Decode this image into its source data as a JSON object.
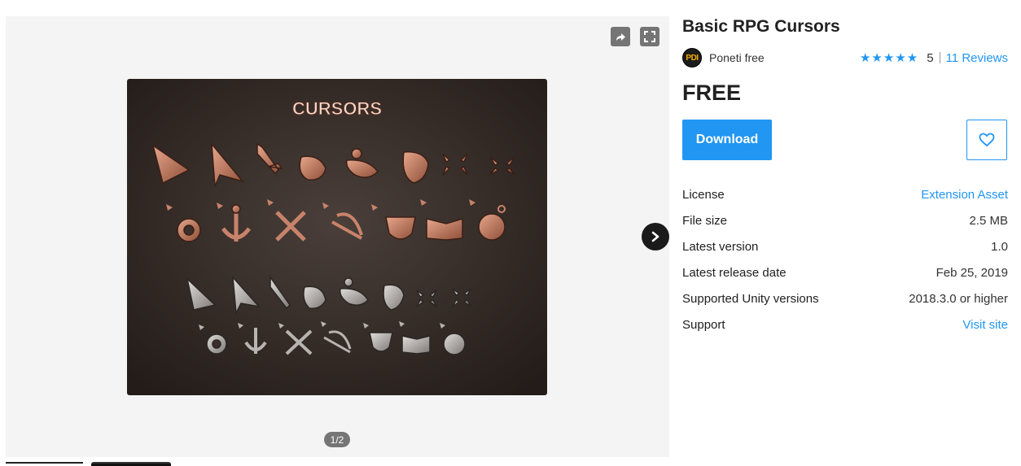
{
  "gallery": {
    "image_title": "CURSORS",
    "page_indicator": "1/2",
    "share_icon": "share-icon",
    "fullscreen_icon": "fullscreen-icon",
    "next_icon": "chevron-right-icon"
  },
  "product": {
    "title": "Basic RPG Cursors",
    "publisher_logo_text": "PDI",
    "publisher": "Poneti free",
    "rating_stars": "★★★★★",
    "rating_value": "5",
    "reviews": "11 Reviews",
    "price": "FREE",
    "download_label": "Download",
    "favorite_icon": "heart-icon"
  },
  "info": [
    {
      "label": "License",
      "value": "Extension Asset",
      "link": true
    },
    {
      "label": "File size",
      "value": "2.5 MB",
      "link": false
    },
    {
      "label": "Latest version",
      "value": "1.0",
      "link": false
    },
    {
      "label": "Latest release date",
      "value": "Feb 25, 2019",
      "link": false
    },
    {
      "label": "Supported Unity versions",
      "value": "2018.3.0 or higher",
      "link": false
    },
    {
      "label": "Support",
      "value": "Visit site",
      "link": true
    }
  ],
  "colors": {
    "accent": "#2196f3",
    "image_bg": "#3a2f2b",
    "copper": "#c8836a",
    "silver": "#b8b4b0"
  }
}
